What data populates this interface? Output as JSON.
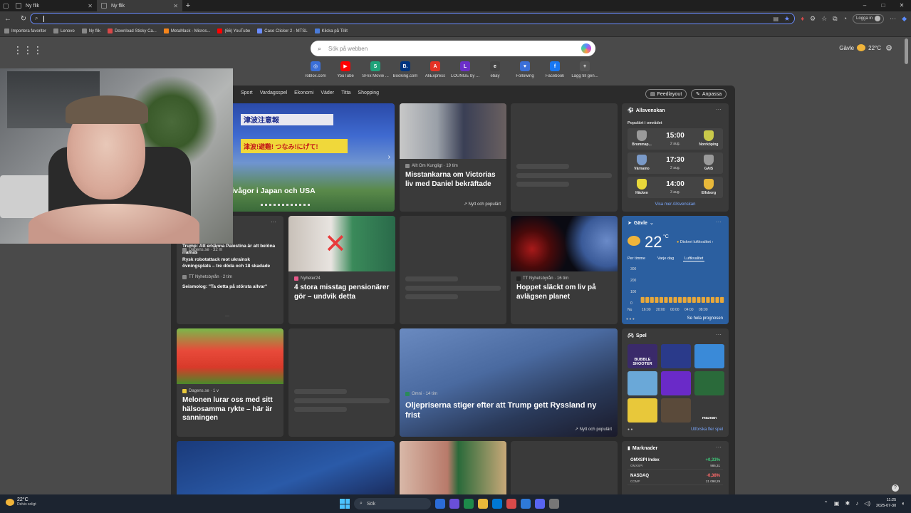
{
  "browser": {
    "tabs": [
      {
        "label": "Ny flik"
      },
      {
        "label": "Ny flik"
      }
    ],
    "new_tab": "+",
    "window_controls": [
      "–",
      "□",
      "✕"
    ],
    "address_value": "",
    "login_label": "Logga in",
    "accent": "#6a8cff"
  },
  "bookmarks": [
    {
      "label": "Importera favoriter",
      "color": "#888888"
    },
    {
      "label": "Lenovo",
      "color": "#888888"
    },
    {
      "label": "Ny flik",
      "color": "#888888"
    },
    {
      "label": "Download Sticky Ca...",
      "color": "#d94848"
    },
    {
      "label": "MetaMask - Micros...",
      "color": "#f6851b"
    },
    {
      "label": "(66) YouTube",
      "color": "#ff0000"
    },
    {
      "label": "Case Clicker 2 - MTSL",
      "color": "#6a8cff"
    },
    {
      "label": "Klicka på Tillit",
      "color": "#4a7bd8"
    }
  ],
  "ntp": {
    "search_placeholder": "Sök på webben",
    "weather_city": "Gävle",
    "weather_temp": "22°C"
  },
  "quick_links": [
    {
      "label": "roblox.com",
      "glyph": "◎",
      "color": "#3b6fd8"
    },
    {
      "label": "YouTube",
      "glyph": "▶",
      "color": "#ff0000"
    },
    {
      "label": "SFlix Movie ...",
      "glyph": "S",
      "color": "#1fa37a"
    },
    {
      "label": "Booking.com",
      "glyph": "B.",
      "color": "#003580"
    },
    {
      "label": "AliExpress",
      "glyph": "A",
      "color": "#e43225"
    },
    {
      "label": "LOUNGE by ...",
      "glyph": "L",
      "color": "#6b2fc9"
    },
    {
      "label": "ebay",
      "glyph": "e",
      "color": "#444444"
    },
    {
      "label": "Following",
      "glyph": "♥",
      "color": "#3b6fd8"
    },
    {
      "label": "Facebook",
      "glyph": "f",
      "color": "#1877f2"
    },
    {
      "label": "Lägg till gen...",
      "glyph": "+",
      "color": "#555555"
    }
  ],
  "feed": {
    "categories": [
      "Sport",
      "Vardagsspel",
      "Ekonomi",
      "Väder",
      "Titta",
      "Shopping"
    ],
    "feedlayout_label": "Feedlayout",
    "customize_label": "Anpassa",
    "hero": {
      "title": "kalv – tsunamivågor i Japan och USA",
      "overlay_jp1": "津波注意報",
      "overlay_jp2": "津波!避難! つなみ!にげて!"
    },
    "royal": {
      "source": "Allt Om Kungligt · 19 tim",
      "title": "Misstankarna om Victorias liv med Daniel bekräftade",
      "trend": "Nytt och populärt"
    },
    "list": {
      "items": [
        {
          "source": "",
          "title": "Trump: Att erkänna Palestina är att belöna Hamas"
        },
        {
          "source": "Dagens.se · 32 m",
          "title": "Rysk robotattack mot ukrainsk övningsplats – tre döda och 18 skadade"
        },
        {
          "source": "TT Nyhetsbyrån · 2 tim",
          "title": "Seismolog: \"Ta detta på största allvar\""
        }
      ]
    },
    "pension": {
      "source": "Nyheter24",
      "title": "4 stora misstag pensionärer gör – undvik detta"
    },
    "planet": {
      "source": "TT Nyhetsbyrån · 16 tim",
      "title": "Hoppet släckt om liv på avlägsen planet"
    },
    "melon": {
      "source": "Dagens.se · 1 v",
      "title": "Melonen lurar oss med sitt hälsosamma rykte – här är sanningen"
    },
    "oil": {
      "source": "Omni · 14 tim",
      "title": "Oljepriserna stiger efter att Trump gett Ryssland ny frist",
      "trend": "Nytt och populärt"
    },
    "dots": "···"
  },
  "allsvenskan": {
    "title": "Allsvenskan",
    "subtitle": "Populärt i området",
    "matches": [
      {
        "home": "Brommap...",
        "away": "Norrköping",
        "time": "15:00",
        "date": "2 aug.",
        "home_color": "#9a9a9a",
        "away_color": "#c9c94a"
      },
      {
        "home": "Värnamo",
        "away": "GAIS",
        "time": "17:30",
        "date": "2 aug.",
        "home_color": "#7a9ac8",
        "away_color": "#9a9a9a"
      },
      {
        "home": "Häcken",
        "away": "Elfsborg",
        "time": "14:00",
        "date": "3 aug.",
        "home_color": "#e8d83a",
        "away_color": "#e8b83a"
      }
    ],
    "more": "Visa mer Allsvenskan"
  },
  "weather": {
    "city": "Gävle",
    "temp": "22",
    "unit": "°C",
    "aq": "Diskret luftkvalitet",
    "tabs": [
      "Per timme",
      "Varje dag",
      "Luftkvalitet"
    ],
    "y_ticks": [
      "300",
      "200",
      "100",
      "0"
    ],
    "x_ticks": [
      "Nu",
      "16:00",
      "20:00",
      "00:00",
      "04:00",
      "08:00"
    ],
    "bars": [
      0.17,
      0.17,
      0.17,
      0.17,
      0.17,
      0.17,
      0.17,
      0.17,
      0.17,
      0.17,
      0.17,
      0.17,
      0.17,
      0.17,
      0.17,
      0.17,
      0.17,
      0.17
    ],
    "forecast_link": "Se hela prognosen",
    "bg": "#2b5fa0",
    "bar_color": "#e8a83a"
  },
  "games": {
    "title": "Spel",
    "explore": "Utforska fler spel",
    "tiles": [
      {
        "label": "BUBBLE SHOOTER",
        "color": "#3a2a6a"
      },
      {
        "label": "",
        "color": "#2a3a8a"
      },
      {
        "label": "",
        "color": "#3a8ad8"
      },
      {
        "label": "",
        "color": "#6aa8d8"
      },
      {
        "label": "",
        "color": "#6a2ac8"
      },
      {
        "label": "",
        "color": "#2a6a3a"
      },
      {
        "label": "",
        "color": "#e8c83a"
      },
      {
        "label": "",
        "color": "#5a4a3a"
      },
      {
        "label": "mazean",
        "color": "#3a3a3a"
      }
    ]
  },
  "markets": {
    "title": "Marknader",
    "rows": [
      {
        "name": "OMXSPI Index",
        "sub": "OMXSPI",
        "change": "+0,33%",
        "value": "986,31",
        "color": "#3fc97a"
      },
      {
        "name": "NASDAQ",
        "sub": "COMP",
        "change": "-0,38%",
        "value": "21 098,29",
        "color": "#ff6b6b"
      }
    ]
  },
  "taskbar": {
    "weather_temp": "22°C",
    "weather_desc": "Delvis soligt",
    "search": "Sök",
    "time": "11:25",
    "date": "2025-07-30",
    "app_colors": [
      "#2b6cd8",
      "#6a4fd8",
      "#1d8a4a",
      "#e8b83a",
      "#0078d4",
      "#d84a4a",
      "#2e7ad8",
      "#5865f2",
      "#777777"
    ]
  },
  "help": "?"
}
